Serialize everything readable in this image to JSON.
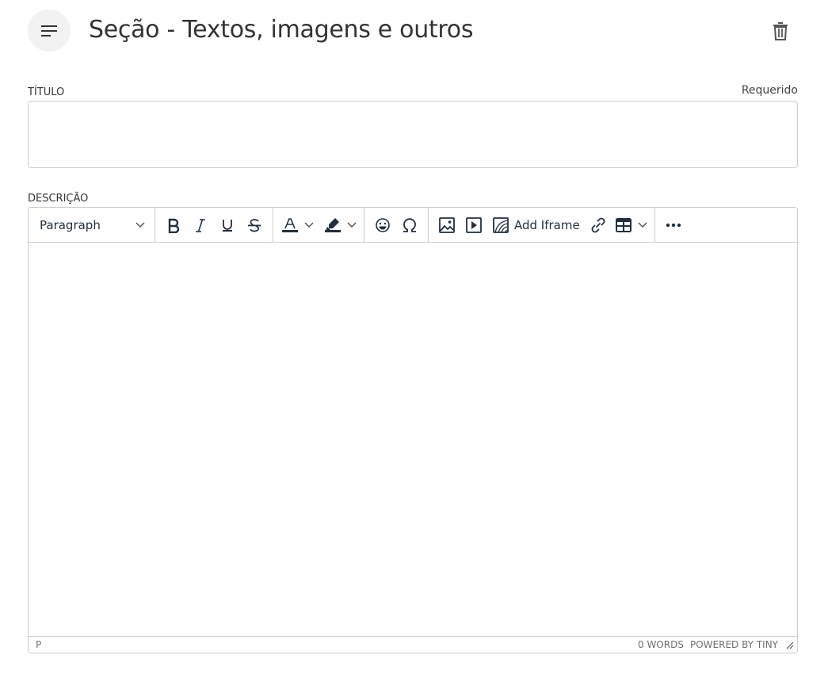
{
  "header": {
    "title": "Seção - Textos, imagens e outros",
    "menu_icon": "menu-icon",
    "delete_icon": "trash-icon"
  },
  "title_field": {
    "label": "Título",
    "required_label": "Requerido",
    "value": ""
  },
  "description_field": {
    "label": "Descrição"
  },
  "toolbar": {
    "block_format": "Paragraph",
    "add_iframe_label": "Add Iframe",
    "icons": [
      "bold-icon",
      "italic-icon",
      "underline-icon",
      "strikethrough-icon",
      "text-color-icon",
      "highlight-color-icon",
      "emoji-icon",
      "special-char-icon",
      "image-icon",
      "media-icon",
      "iframe-icon",
      "link-icon",
      "table-icon",
      "more-icon"
    ],
    "text_color": "#222f3e",
    "highlight_color": "#222f3e"
  },
  "statusbar": {
    "path": "P",
    "word_count": "0 words",
    "branding": "Powered by Tiny"
  }
}
